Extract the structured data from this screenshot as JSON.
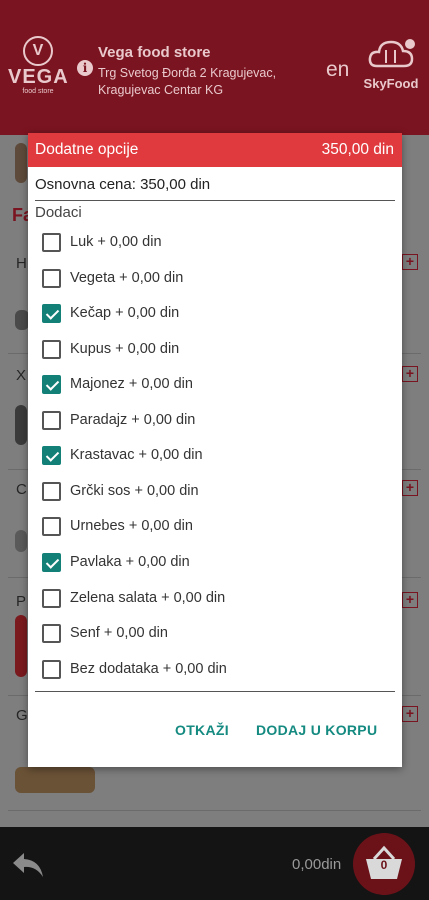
{
  "header": {
    "logo_text": "VEGA",
    "logo_sub": "food store",
    "store_name": "Vega food store",
    "address_line1": "Trg Svetog Đorđa 2 Kragujevac,",
    "address_line2": "Kragujevac Centar KG",
    "language": "en",
    "brand": "SkyFood",
    "icons": [
      "info-icon",
      "skyfood-cloud-icon"
    ]
  },
  "background": {
    "section_letter": "Fa",
    "row_letters": [
      "H",
      "X",
      "C",
      "P",
      "G"
    ]
  },
  "dialog": {
    "title": "Dodatne opcije",
    "price": "350,00 din",
    "base_price": "Osnovna cena: 350,00 din",
    "section_label": "Dodaci",
    "options": [
      {
        "label": "Luk + 0,00 din",
        "checked": false
      },
      {
        "label": "Vegeta + 0,00 din",
        "checked": false
      },
      {
        "label": "Kečap + 0,00 din",
        "checked": true
      },
      {
        "label": "Kupus + 0,00 din",
        "checked": false
      },
      {
        "label": "Majonez + 0,00 din",
        "checked": true
      },
      {
        "label": "Paradajz + 0,00 din",
        "checked": false
      },
      {
        "label": "Krastavac + 0,00 din",
        "checked": true
      },
      {
        "label": "Grčki sos + 0,00 din",
        "checked": false
      },
      {
        "label": "Urnebes + 0,00 din",
        "checked": false
      },
      {
        "label": "Pavlaka + 0,00 din",
        "checked": true
      },
      {
        "label": "Zelena salata + 0,00 din",
        "checked": false
      },
      {
        "label": "Senf + 0,00 din",
        "checked": false
      },
      {
        "label": "Bez dodataka + 0,00 din",
        "checked": false
      }
    ],
    "cancel_label": "OTKAŽI",
    "add_label": "DODAJ U KORPU"
  },
  "bottom": {
    "total": "0,00din",
    "cart_count": "0"
  },
  "colors": {
    "header_bg": "#7a1420",
    "dialog_title_bg": "#e03a3e",
    "checkbox_accent": "#138078",
    "button_text": "#148a80"
  }
}
